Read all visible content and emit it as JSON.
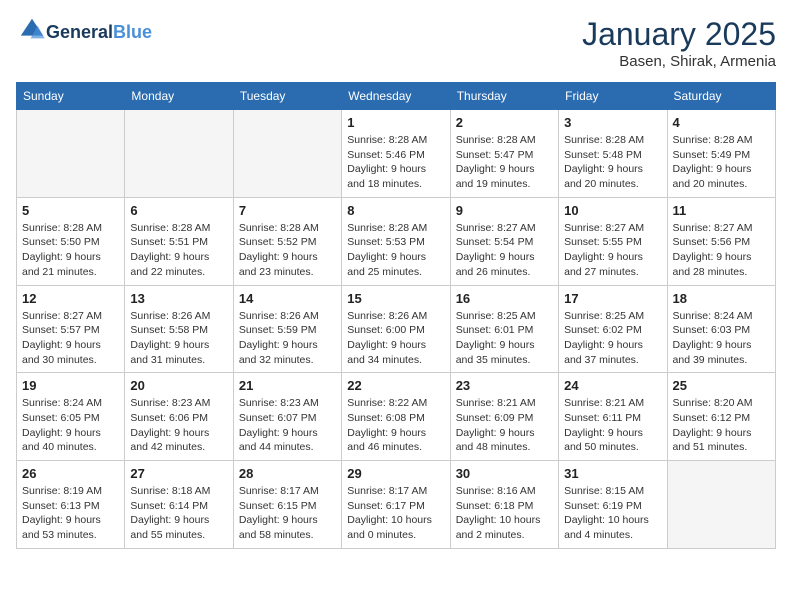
{
  "header": {
    "logo_line1": "General",
    "logo_line2": "Blue",
    "month": "January 2025",
    "location": "Basen, Shirak, Armenia"
  },
  "weekdays": [
    "Sunday",
    "Monday",
    "Tuesday",
    "Wednesday",
    "Thursday",
    "Friday",
    "Saturday"
  ],
  "weeks": [
    [
      {
        "day": "",
        "info": ""
      },
      {
        "day": "",
        "info": ""
      },
      {
        "day": "",
        "info": ""
      },
      {
        "day": "1",
        "info": "Sunrise: 8:28 AM\nSunset: 5:46 PM\nDaylight: 9 hours\nand 18 minutes."
      },
      {
        "day": "2",
        "info": "Sunrise: 8:28 AM\nSunset: 5:47 PM\nDaylight: 9 hours\nand 19 minutes."
      },
      {
        "day": "3",
        "info": "Sunrise: 8:28 AM\nSunset: 5:48 PM\nDaylight: 9 hours\nand 20 minutes."
      },
      {
        "day": "4",
        "info": "Sunrise: 8:28 AM\nSunset: 5:49 PM\nDaylight: 9 hours\nand 20 minutes."
      }
    ],
    [
      {
        "day": "5",
        "info": "Sunrise: 8:28 AM\nSunset: 5:50 PM\nDaylight: 9 hours\nand 21 minutes."
      },
      {
        "day": "6",
        "info": "Sunrise: 8:28 AM\nSunset: 5:51 PM\nDaylight: 9 hours\nand 22 minutes."
      },
      {
        "day": "7",
        "info": "Sunrise: 8:28 AM\nSunset: 5:52 PM\nDaylight: 9 hours\nand 23 minutes."
      },
      {
        "day": "8",
        "info": "Sunrise: 8:28 AM\nSunset: 5:53 PM\nDaylight: 9 hours\nand 25 minutes."
      },
      {
        "day": "9",
        "info": "Sunrise: 8:27 AM\nSunset: 5:54 PM\nDaylight: 9 hours\nand 26 minutes."
      },
      {
        "day": "10",
        "info": "Sunrise: 8:27 AM\nSunset: 5:55 PM\nDaylight: 9 hours\nand 27 minutes."
      },
      {
        "day": "11",
        "info": "Sunrise: 8:27 AM\nSunset: 5:56 PM\nDaylight: 9 hours\nand 28 minutes."
      }
    ],
    [
      {
        "day": "12",
        "info": "Sunrise: 8:27 AM\nSunset: 5:57 PM\nDaylight: 9 hours\nand 30 minutes."
      },
      {
        "day": "13",
        "info": "Sunrise: 8:26 AM\nSunset: 5:58 PM\nDaylight: 9 hours\nand 31 minutes."
      },
      {
        "day": "14",
        "info": "Sunrise: 8:26 AM\nSunset: 5:59 PM\nDaylight: 9 hours\nand 32 minutes."
      },
      {
        "day": "15",
        "info": "Sunrise: 8:26 AM\nSunset: 6:00 PM\nDaylight: 9 hours\nand 34 minutes."
      },
      {
        "day": "16",
        "info": "Sunrise: 8:25 AM\nSunset: 6:01 PM\nDaylight: 9 hours\nand 35 minutes."
      },
      {
        "day": "17",
        "info": "Sunrise: 8:25 AM\nSunset: 6:02 PM\nDaylight: 9 hours\nand 37 minutes."
      },
      {
        "day": "18",
        "info": "Sunrise: 8:24 AM\nSunset: 6:03 PM\nDaylight: 9 hours\nand 39 minutes."
      }
    ],
    [
      {
        "day": "19",
        "info": "Sunrise: 8:24 AM\nSunset: 6:05 PM\nDaylight: 9 hours\nand 40 minutes."
      },
      {
        "day": "20",
        "info": "Sunrise: 8:23 AM\nSunset: 6:06 PM\nDaylight: 9 hours\nand 42 minutes."
      },
      {
        "day": "21",
        "info": "Sunrise: 8:23 AM\nSunset: 6:07 PM\nDaylight: 9 hours\nand 44 minutes."
      },
      {
        "day": "22",
        "info": "Sunrise: 8:22 AM\nSunset: 6:08 PM\nDaylight: 9 hours\nand 46 minutes."
      },
      {
        "day": "23",
        "info": "Sunrise: 8:21 AM\nSunset: 6:09 PM\nDaylight: 9 hours\nand 48 minutes."
      },
      {
        "day": "24",
        "info": "Sunrise: 8:21 AM\nSunset: 6:11 PM\nDaylight: 9 hours\nand 50 minutes."
      },
      {
        "day": "25",
        "info": "Sunrise: 8:20 AM\nSunset: 6:12 PM\nDaylight: 9 hours\nand 51 minutes."
      }
    ],
    [
      {
        "day": "26",
        "info": "Sunrise: 8:19 AM\nSunset: 6:13 PM\nDaylight: 9 hours\nand 53 minutes."
      },
      {
        "day": "27",
        "info": "Sunrise: 8:18 AM\nSunset: 6:14 PM\nDaylight: 9 hours\nand 55 minutes."
      },
      {
        "day": "28",
        "info": "Sunrise: 8:17 AM\nSunset: 6:15 PM\nDaylight: 9 hours\nand 58 minutes."
      },
      {
        "day": "29",
        "info": "Sunrise: 8:17 AM\nSunset: 6:17 PM\nDaylight: 10 hours\nand 0 minutes."
      },
      {
        "day": "30",
        "info": "Sunrise: 8:16 AM\nSunset: 6:18 PM\nDaylight: 10 hours\nand 2 minutes."
      },
      {
        "day": "31",
        "info": "Sunrise: 8:15 AM\nSunset: 6:19 PM\nDaylight: 10 hours\nand 4 minutes."
      },
      {
        "day": "",
        "info": ""
      }
    ]
  ]
}
